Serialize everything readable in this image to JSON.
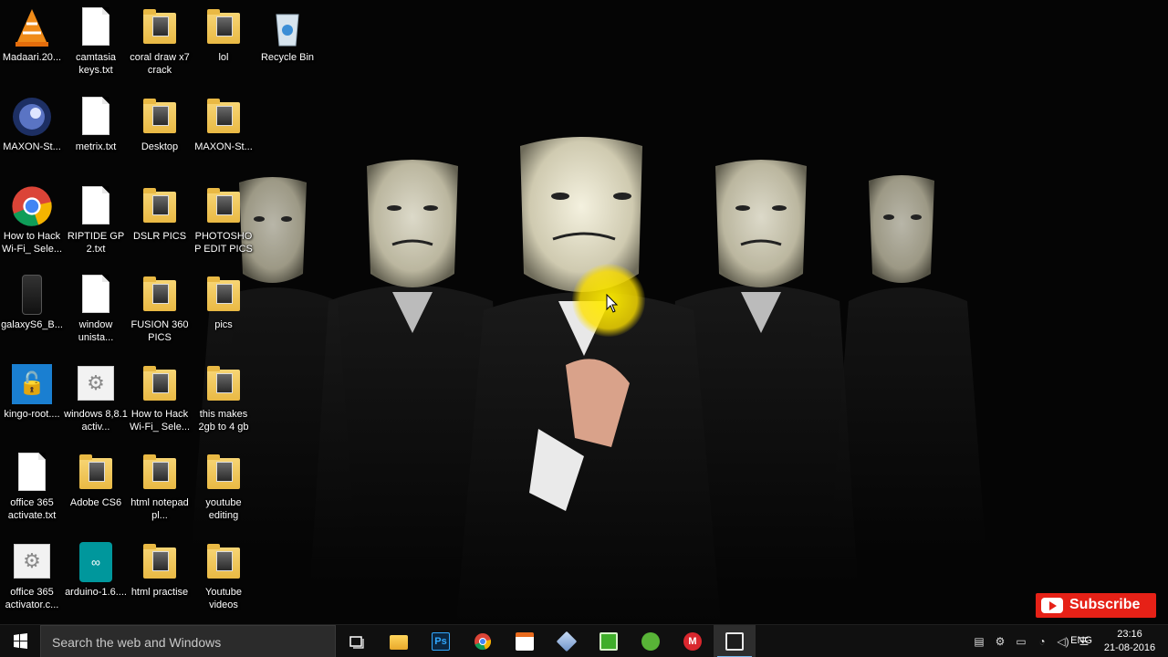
{
  "desktop": {
    "icons": [
      {
        "label": "Madaari.20...",
        "kind": "vlc"
      },
      {
        "label": "camtasia keys.txt",
        "kind": "doc"
      },
      {
        "label": "coral draw x7 crack",
        "kind": "folder"
      },
      {
        "label": "lol",
        "kind": "folder"
      },
      {
        "label": "Recycle Bin",
        "kind": "recycle"
      },
      {
        "label": "MAXON-St...",
        "kind": "cinema4d"
      },
      {
        "label": "metrix.txt",
        "kind": "doc"
      },
      {
        "label": "Desktop",
        "kind": "folder"
      },
      {
        "label": "MAXON-St...",
        "kind": "folder"
      },
      {
        "label": "How to Hack Wi-Fi_ Sele...",
        "kind": "chrome"
      },
      {
        "label": "RIPTIDE GP 2.txt",
        "kind": "doc"
      },
      {
        "label": "DSLR PICS",
        "kind": "folder"
      },
      {
        "label": "PHOTOSHOP EDIT PICS",
        "kind": "folder"
      },
      {
        "label": "galaxyS6_B...",
        "kind": "phone"
      },
      {
        "label": "window unista...",
        "kind": "doc"
      },
      {
        "label": "FUSION 360 PICS",
        "kind": "folder"
      },
      {
        "label": "pics",
        "kind": "folder"
      },
      {
        "label": "kingo-root....",
        "kind": "kingo"
      },
      {
        "label": "windows 8,8.1 activ...",
        "kind": "gear"
      },
      {
        "label": "How to Hack Wi-Fi_ Sele...",
        "kind": "folder"
      },
      {
        "label": "this makes 2gb to 4 gb",
        "kind": "folder"
      },
      {
        "label": "office 365 activate.txt",
        "kind": "doc"
      },
      {
        "label": "Adobe CS6",
        "kind": "folder"
      },
      {
        "label": "html notepad pl...",
        "kind": "folder"
      },
      {
        "label": "youtube editing",
        "kind": "folder"
      },
      {
        "label": "office 365 activator.c...",
        "kind": "gear"
      },
      {
        "label": "arduino-1.6....",
        "kind": "arduino"
      },
      {
        "label": "html practise",
        "kind": "folder"
      },
      {
        "label": "Youtube videos",
        "kind": "folder"
      }
    ]
  },
  "taskbar": {
    "search_placeholder": "Search the web and Windows",
    "apps": [
      "task-view",
      "file-explorer",
      "photoshop",
      "chrome",
      "foxit",
      "virtualbox",
      "camtasia",
      "utorrent",
      "mega",
      "camtasia-recorder"
    ],
    "language": "ENG",
    "time": "23:16",
    "date": "21-08-2016"
  },
  "subscribe": {
    "label": "Subscribe"
  },
  "colors": {
    "taskbar": "#101010",
    "accent": "#76b9ed",
    "subscribe": "#e62117",
    "halo": "#ffee00"
  }
}
